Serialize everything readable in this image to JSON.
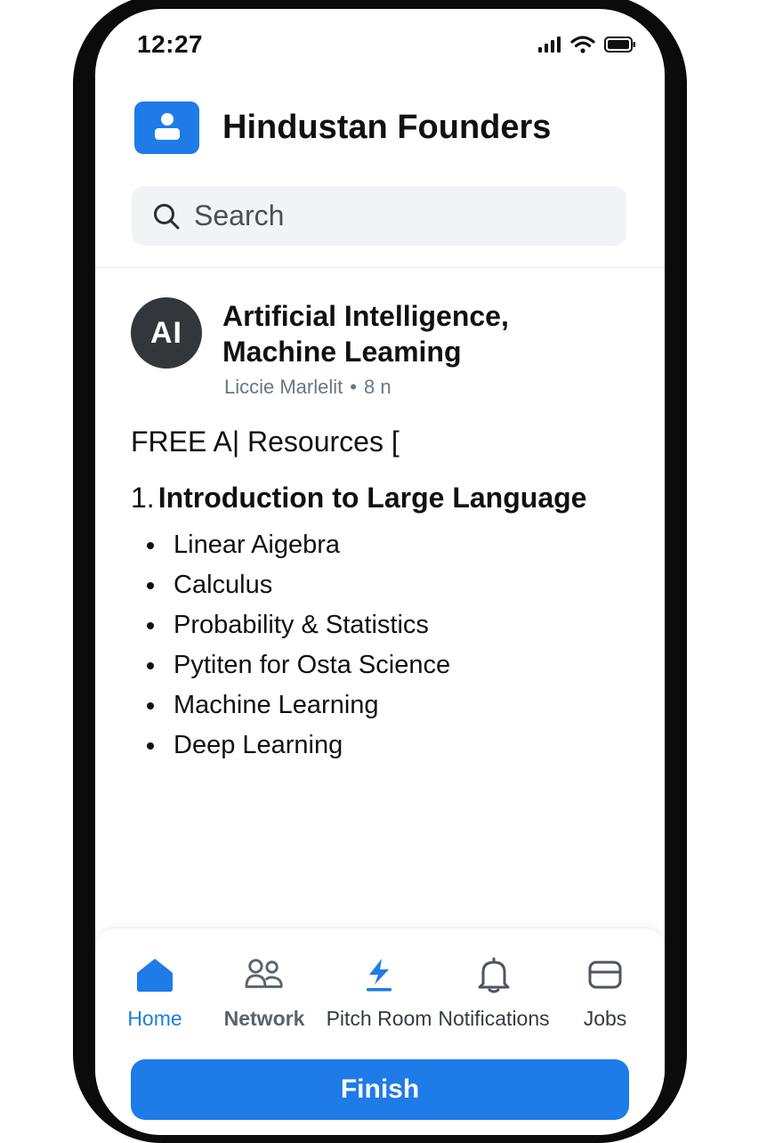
{
  "status_bar": {
    "time": "12:27"
  },
  "header": {
    "title": "Hindustan Founders",
    "logo_icon": "user-badge-icon"
  },
  "search": {
    "placeholder": "Search"
  },
  "post": {
    "avatar_text": "AI",
    "title_line1": "Artificial Intelligence,",
    "title_line2": "Machine Leaming",
    "author": "Liccie Marlelit",
    "separator": "•",
    "time": "8 n",
    "intro": "FREE A| Resources [",
    "section_number": "1.",
    "section_title": "Introduction to Large Language",
    "items": [
      "Linear Aigebra",
      "Calculus",
      "Probability & Statistics",
      "Pytiten for Osta Science",
      "Machine Learning",
      "Deep Learning"
    ]
  },
  "bottom_nav": {
    "items": [
      {
        "label": "Home",
        "icon": "home-icon",
        "active": true
      },
      {
        "label": "Network",
        "icon": "network-icon"
      },
      {
        "label": "Pitch Room",
        "icon": "lightning-icon"
      },
      {
        "label": "Notifications",
        "icon": "bell-icon"
      },
      {
        "label": "Jobs",
        "icon": "briefcase-icon"
      }
    ],
    "finish_label": "Finish"
  },
  "colors": {
    "accent": "#1e7be8",
    "avatar_bg": "#33373b",
    "search_bg": "#f1f3f7",
    "meta_text": "#6a7683"
  }
}
